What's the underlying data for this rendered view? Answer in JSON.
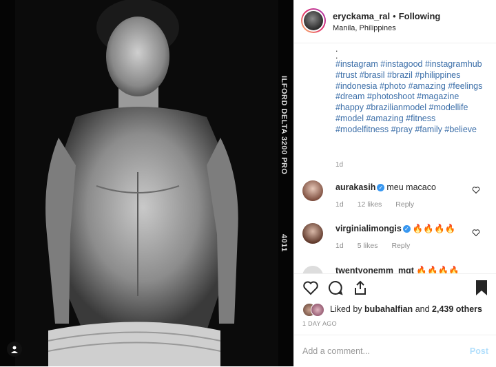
{
  "post": {
    "username": "eryckama_ral",
    "separator": "•",
    "following_label": "Following",
    "location": "Manila, Philippines",
    "caption_dots": [
      ".",
      "."
    ],
    "caption_tags": "#instagram #instagood #instagramhub #trust #brasil #brazil #philippines #indonesia #photo #amazing #feelings #dream #photoshoot #magazine #happy #brazilianmodel #modellife #model #amazing #fitness #modelfitness #pray #family #believe",
    "caption_age": "1d"
  },
  "photo": {
    "film_label_top": "ILFORD DELTA 3200 PRO",
    "film_label_bottom": "4011"
  },
  "comments": [
    {
      "username": "aurakasih",
      "verified": true,
      "text": "meu macaco",
      "age": "1d",
      "likes": "12 likes",
      "reply": "Reply"
    },
    {
      "username": "virginialimongis",
      "verified": true,
      "text": "🔥🔥🔥🔥",
      "age": "1d",
      "likes": "5 likes",
      "reply": "Reply"
    },
    {
      "username": "twentyonemm_mgt",
      "verified": false,
      "text": "🔥🔥🔥🔥",
      "age": "",
      "likes": "",
      "reply": ""
    }
  ],
  "likes": {
    "prefix": "Liked by",
    "user": "bubahalfian",
    "middle": "and",
    "others": "2,439 others"
  },
  "time_ago": "1 DAY AGO",
  "comment_box": {
    "placeholder": "Add a comment...",
    "post_label": "Post"
  },
  "icons": {
    "like": "heart-icon",
    "comment": "comment-icon",
    "share": "share-icon",
    "save": "bookmark-icon",
    "verified": "verified-badge-icon",
    "comment_like": "heart-outline-icon"
  },
  "colors": {
    "hashtag": "#3b6ea8",
    "verified": "#3897f0",
    "muted": "#8e8e8e",
    "post_disabled": "#b2dffc"
  }
}
